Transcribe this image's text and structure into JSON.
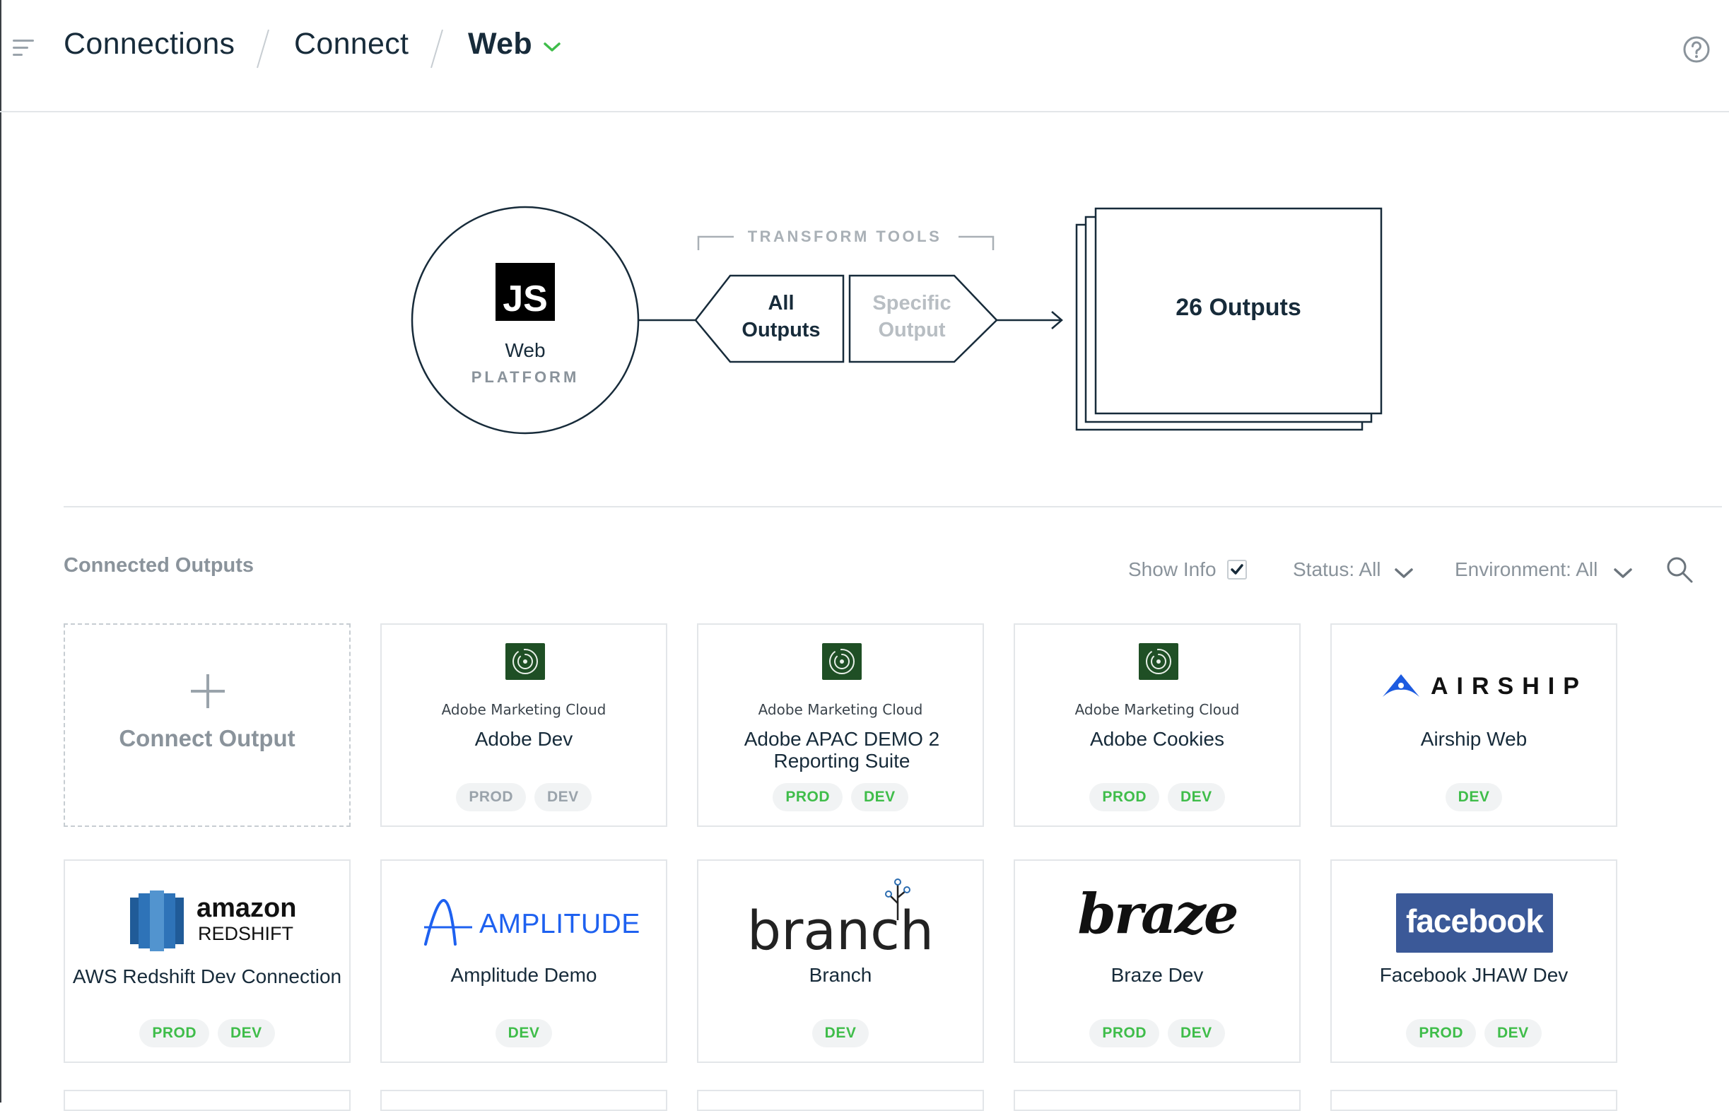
{
  "breadcrumb": [
    "Connections",
    "Connect",
    "Web"
  ],
  "header": {
    "help_icon": "question-circle-icon",
    "menu_icon": "menu-lines-icon"
  },
  "diagram": {
    "source_logo_text": "JS",
    "source_name": "Web",
    "source_type": "PLATFORM",
    "transform_label": "TRANSFORM TOOLS",
    "option_all": "All Outputs",
    "option_specific": "Specific Output",
    "outputs_label": "26 Outputs"
  },
  "connected": {
    "title": "Connected Outputs",
    "show_info": "Show Info",
    "show_info_checked": true,
    "status_filter": "Status: All",
    "environment_filter": "Environment: All"
  },
  "add_card": {
    "label": "Connect Output"
  },
  "outputs": [
    {
      "name": "Adobe Dev",
      "logo": "Adobe Marketing Cloud",
      "badges": [
        {
          "label": "PROD",
          "active": false
        },
        {
          "label": "DEV",
          "active": false
        }
      ]
    },
    {
      "name": "Adobe APAC DEMO 2 Reporting Suite",
      "logo": "Adobe Marketing Cloud",
      "badges": [
        {
          "label": "PROD",
          "active": true
        },
        {
          "label": "DEV",
          "active": true
        }
      ]
    },
    {
      "name": "Adobe Cookies",
      "logo": "Adobe Marketing Cloud",
      "badges": [
        {
          "label": "PROD",
          "active": true
        },
        {
          "label": "DEV",
          "active": true
        }
      ]
    },
    {
      "name": "Airship Web",
      "logo": "AIRSHIP",
      "badges": [
        {
          "label": "DEV",
          "active": true
        }
      ]
    },
    {
      "name": "AWS Redshift Dev Connection",
      "logo": "amazon REDSHIFT",
      "badges": [
        {
          "label": "PROD",
          "active": true
        },
        {
          "label": "DEV",
          "active": true
        }
      ]
    },
    {
      "name": "Amplitude Demo",
      "logo": "AMPLITUDE",
      "badges": [
        {
          "label": "DEV",
          "active": true
        }
      ]
    },
    {
      "name": "Branch",
      "logo": "branch",
      "badges": [
        {
          "label": "DEV",
          "active": true
        }
      ]
    },
    {
      "name": "Braze Dev",
      "logo": "braze",
      "badges": [
        {
          "label": "PROD",
          "active": true
        },
        {
          "label": "DEV",
          "active": true
        }
      ]
    },
    {
      "name": "Facebook JHAW Dev",
      "logo": "facebook",
      "badges": [
        {
          "label": "PROD",
          "active": true
        },
        {
          "label": "DEV",
          "active": true
        }
      ]
    }
  ],
  "logo_text": {
    "amc": "Adobe Marketing Cloud",
    "airship": "AIRSHIP",
    "amazon": "amazon",
    "redshift": "REDSHIFT",
    "amplitude": "AMPLITUDE",
    "branch": "branch",
    "braze": "braze",
    "facebook": "facebook"
  },
  "colors": {
    "accent_green": "#3fbd4a",
    "navy": "#172b3a",
    "muted": "#8a939b",
    "facebook_blue": "#3b5998",
    "airship_blue": "#1d5be0",
    "amplitude_blue": "#1e61f0"
  }
}
